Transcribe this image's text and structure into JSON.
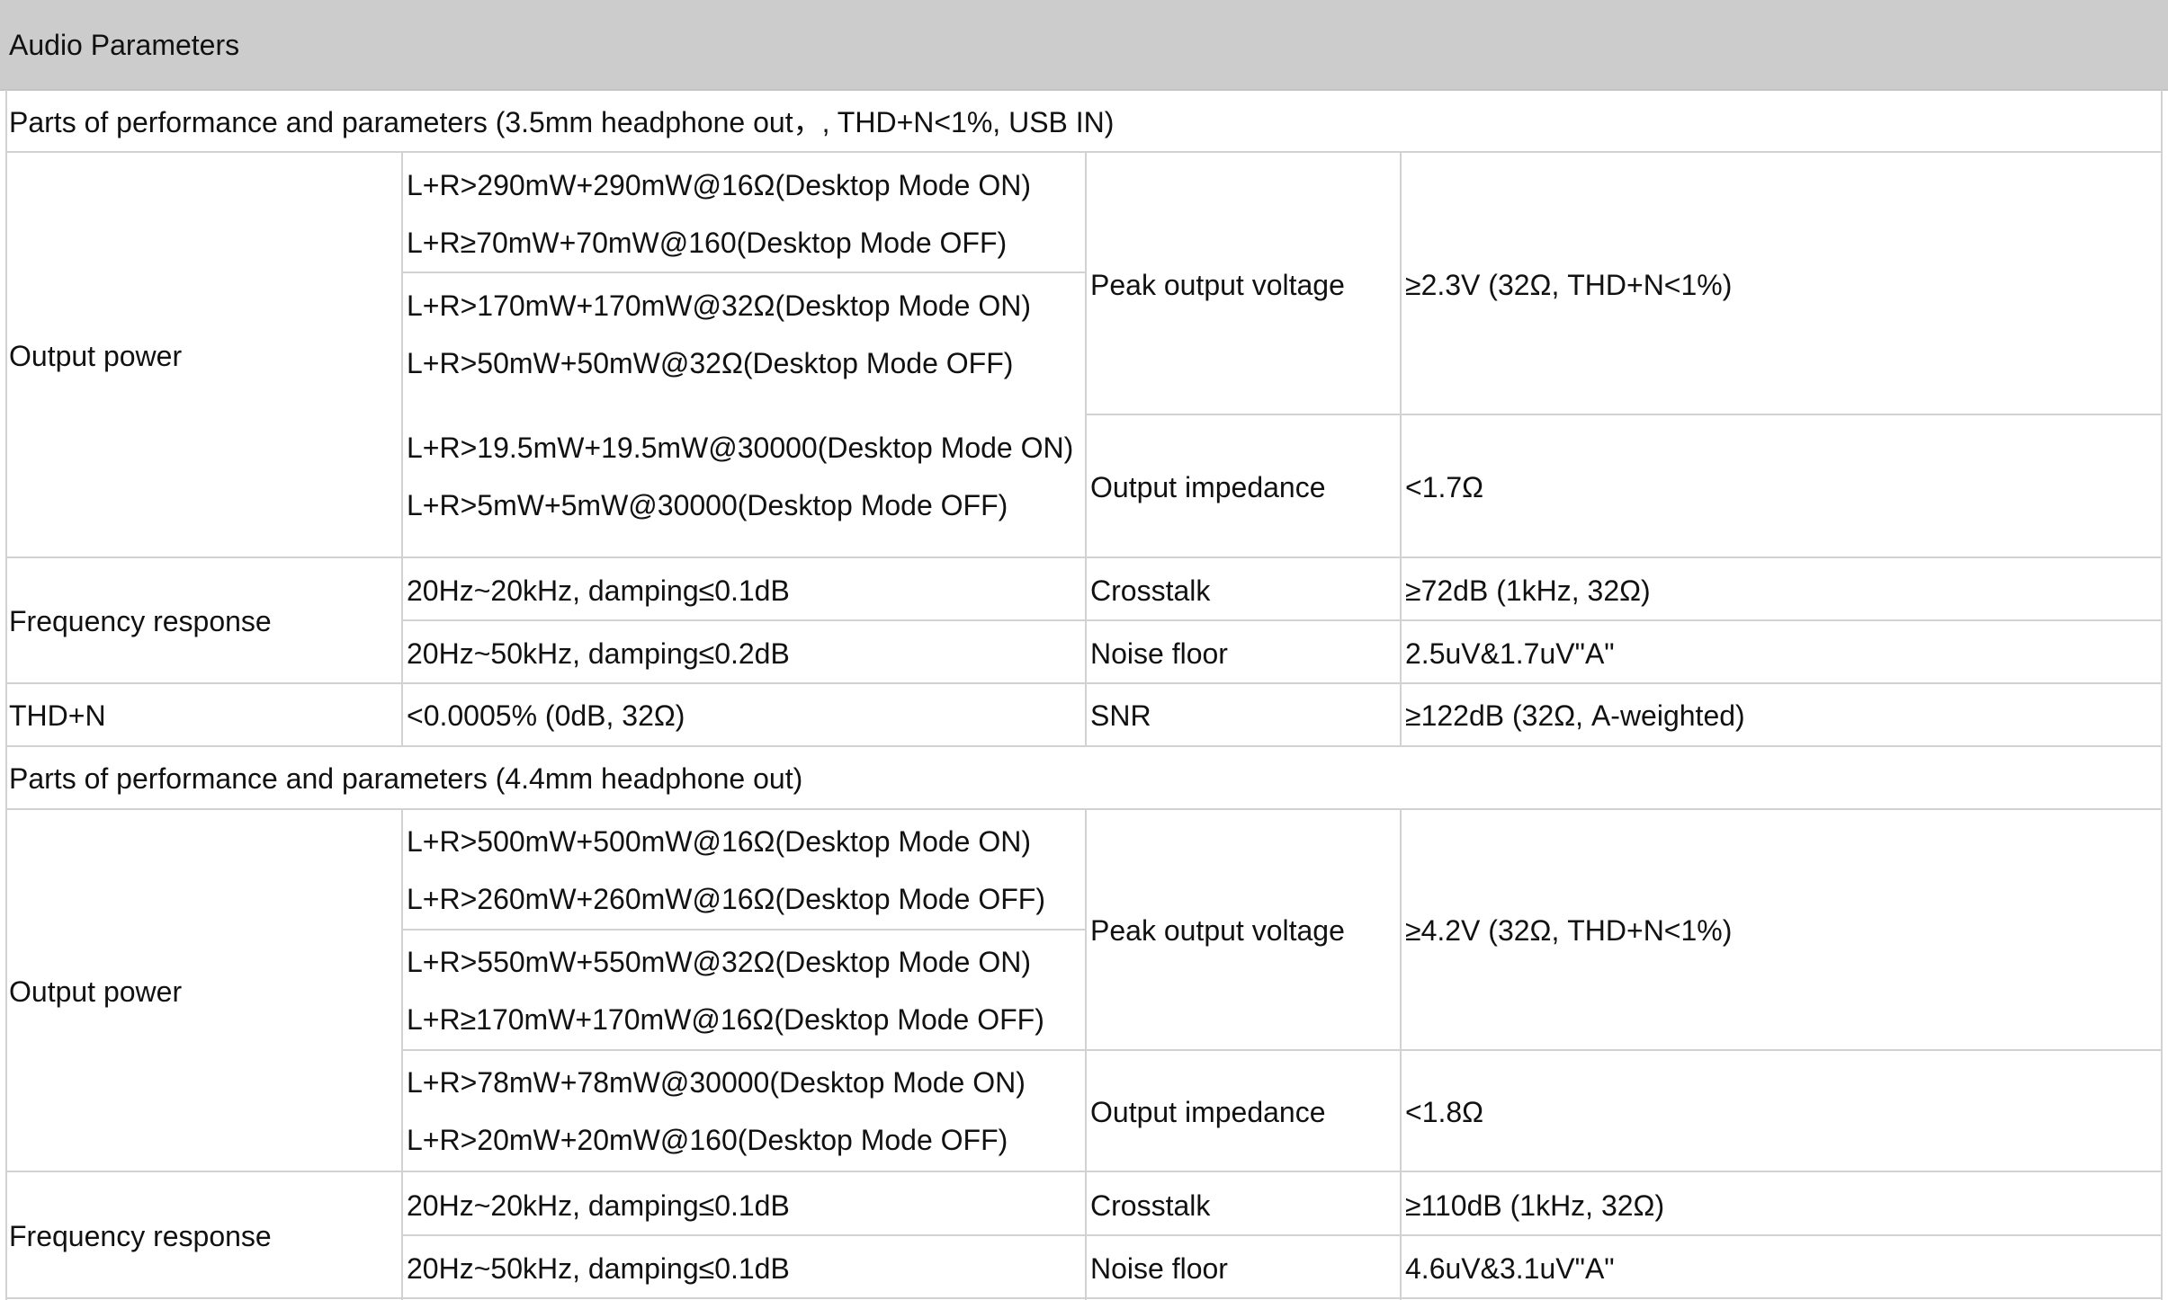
{
  "title": "Audio Parameters",
  "sections": [
    {
      "heading": "Parts of performance and parameters (3.5mm headphone out，, THD+N<1%, USB IN)",
      "output_power": {
        "label": "Output power",
        "lines": [
          "L+R>290mW+290mW@16Ω(Desktop Mode ON)",
          "L+R≥70mW+70mW@160(Desktop Mode OFF)",
          "L+R>170mW+170mW@32Ω(Desktop Mode ON)",
          "L+R>50mW+50mW@32Ω(Desktop Mode OFF)",
          "L+R>19.5mW+19.5mW@30000(Desktop Mode ON)",
          "L+R>5mW+5mW@30000(Desktop Mode OFF)"
        ]
      },
      "peak_output_voltage": {
        "label": "Peak output voltage",
        "value": "≥2.3V (32Ω, THD+N<1%)"
      },
      "output_impedance": {
        "label": "Output impedance",
        "value": "<1.7Ω"
      },
      "frequency_response": {
        "label": "Frequency response",
        "lines": [
          "20Hz~20kHz, damping≤0.1dB",
          "20Hz~50kHz, damping≤0.2dB"
        ]
      },
      "crosstalk": {
        "label": "Crosstalk",
        "value": "≥72dB (1kHz, 32Ω)"
      },
      "noise_floor": {
        "label": "Noise floor",
        "value": "2.5uV&1.7uV\"A\""
      },
      "thd": {
        "label": "THD+N",
        "value": "<0.0005% (0dB, 32Ω)"
      },
      "snr": {
        "label": "SNR",
        "value": "≥122dB (32Ω, A-weighted)"
      }
    },
    {
      "heading": "Parts of performance and parameters (4.4mm headphone out)",
      "output_power": {
        "label": "Output power",
        "lines": [
          "L+R>500mW+500mW@16Ω(Desktop Mode ON)",
          "L+R>260mW+260mW@16Ω(Desktop Mode OFF)",
          "L+R>550mW+550mW@32Ω(Desktop Mode ON)",
          "L+R≥170mW+170mW@16Ω(Desktop Mode OFF)",
          "L+R>78mW+78mW@30000(Desktop Mode ON)",
          "L+R>20mW+20mW@160(Desktop Mode OFF)"
        ]
      },
      "peak_output_voltage": {
        "label": "Peak output voltage",
        "value": "≥4.2V (32Ω, THD+N<1%)"
      },
      "output_impedance": {
        "label": "Output impedance",
        "value": "<1.8Ω"
      },
      "frequency_response": {
        "label": "Frequency response",
        "lines": [
          "20Hz~20kHz, damping≤0.1dB",
          "20Hz~50kHz, damping≤0.1dB"
        ]
      },
      "crosstalk": {
        "label": "Crosstalk",
        "value": "≥110dB (1kHz, 32Ω)"
      },
      "noise_floor": {
        "label": "Noise floor",
        "value": "4.6uV&3.1uV\"A\""
      }
    }
  ]
}
